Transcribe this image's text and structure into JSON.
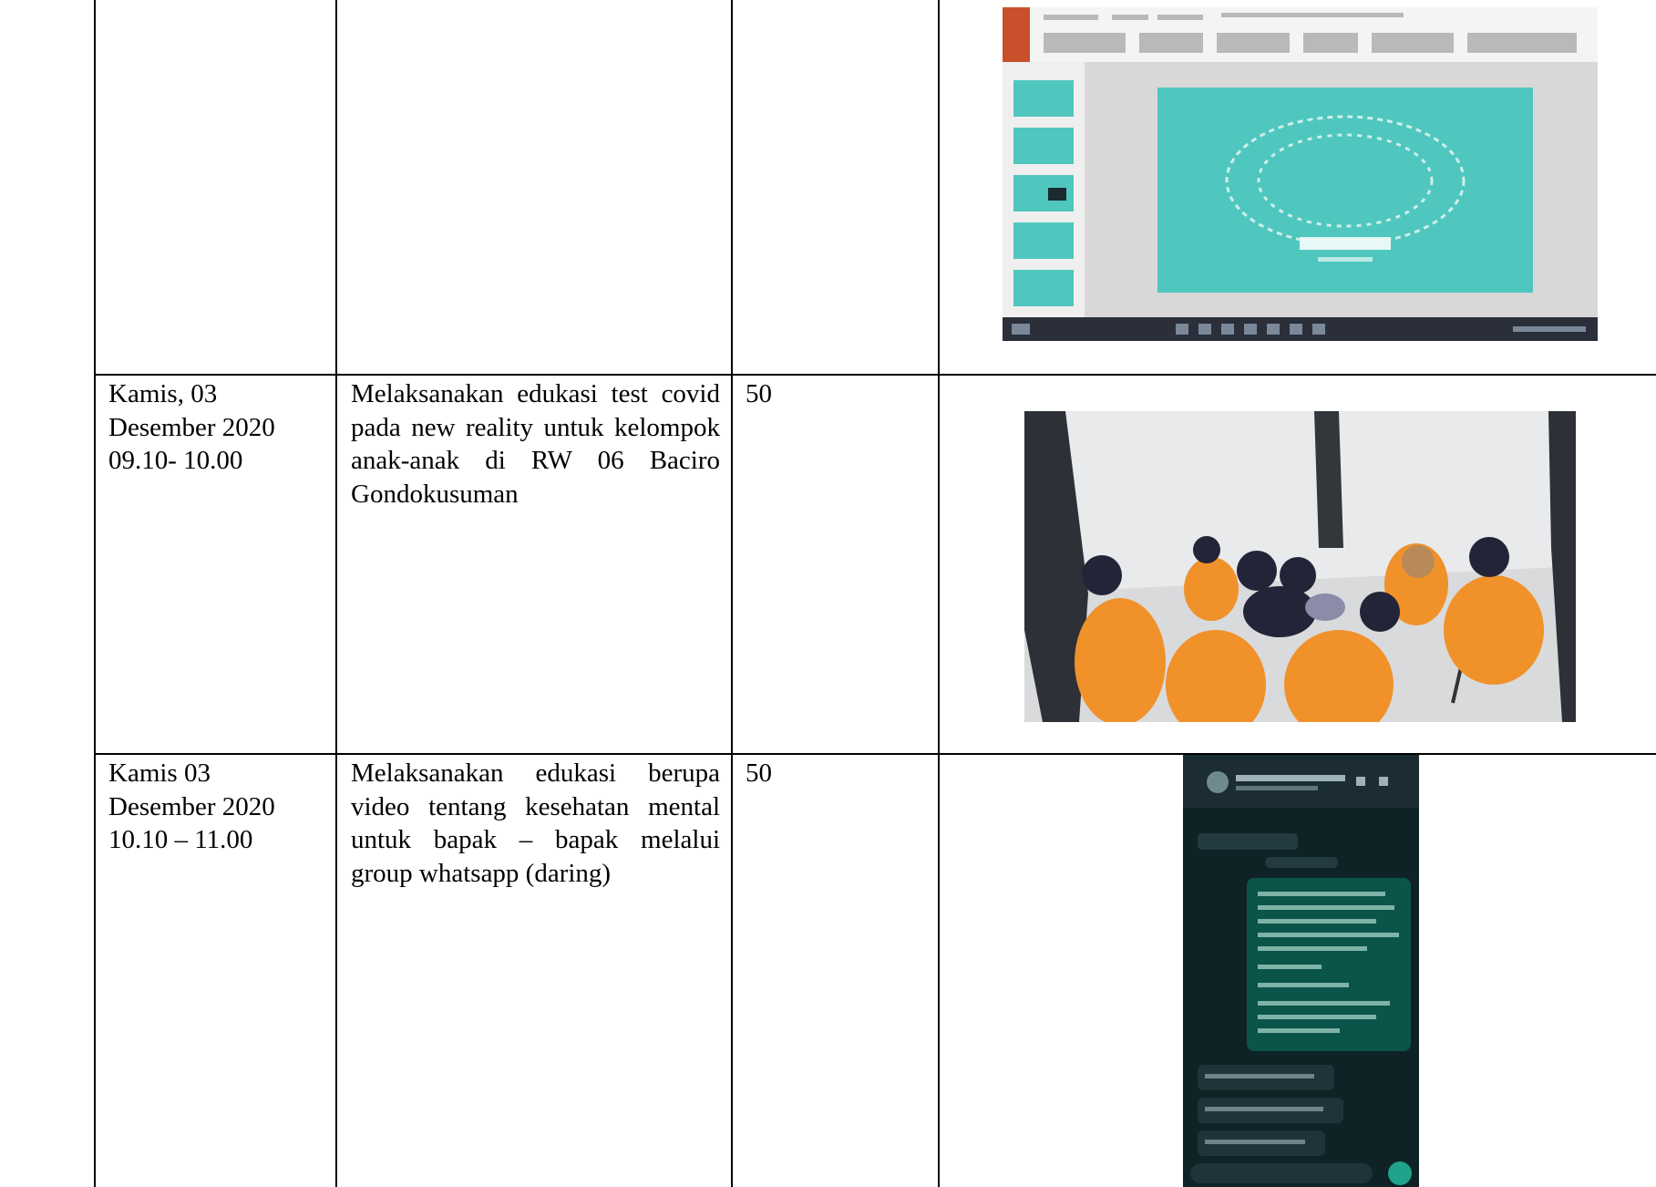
{
  "table": {
    "rows": [
      {
        "date": [
          "",
          "",
          ""
        ],
        "activity": "",
        "count": "",
        "photo": "presentation-slide-screenshot"
      },
      {
        "date": [
          "Kamis, 03",
          "Desember 2020",
          "09.10- 10.00"
        ],
        "activity": "Melaksanakan edukasi test covid pada new reality untuk kelompok anak-anak di RW 06 Baciro Gondokusuman",
        "count": "50",
        "photo": "group-session-photo"
      },
      {
        "date": [
          "Kamis 03",
          "Desember 2020",
          "10.10 – 11.00"
        ],
        "activity": "Melaksanakan edukasi berupa video tentang kesehatan mental untuk bapak – bapak melalui group whatsapp (daring)",
        "count": "50",
        "photo": "whatsapp-chat-screenshot"
      }
    ]
  },
  "colors": {
    "slide_teal": "#4fc7be",
    "uniform_orange": "#f0912a",
    "chat_dark": "#0f2226"
  }
}
